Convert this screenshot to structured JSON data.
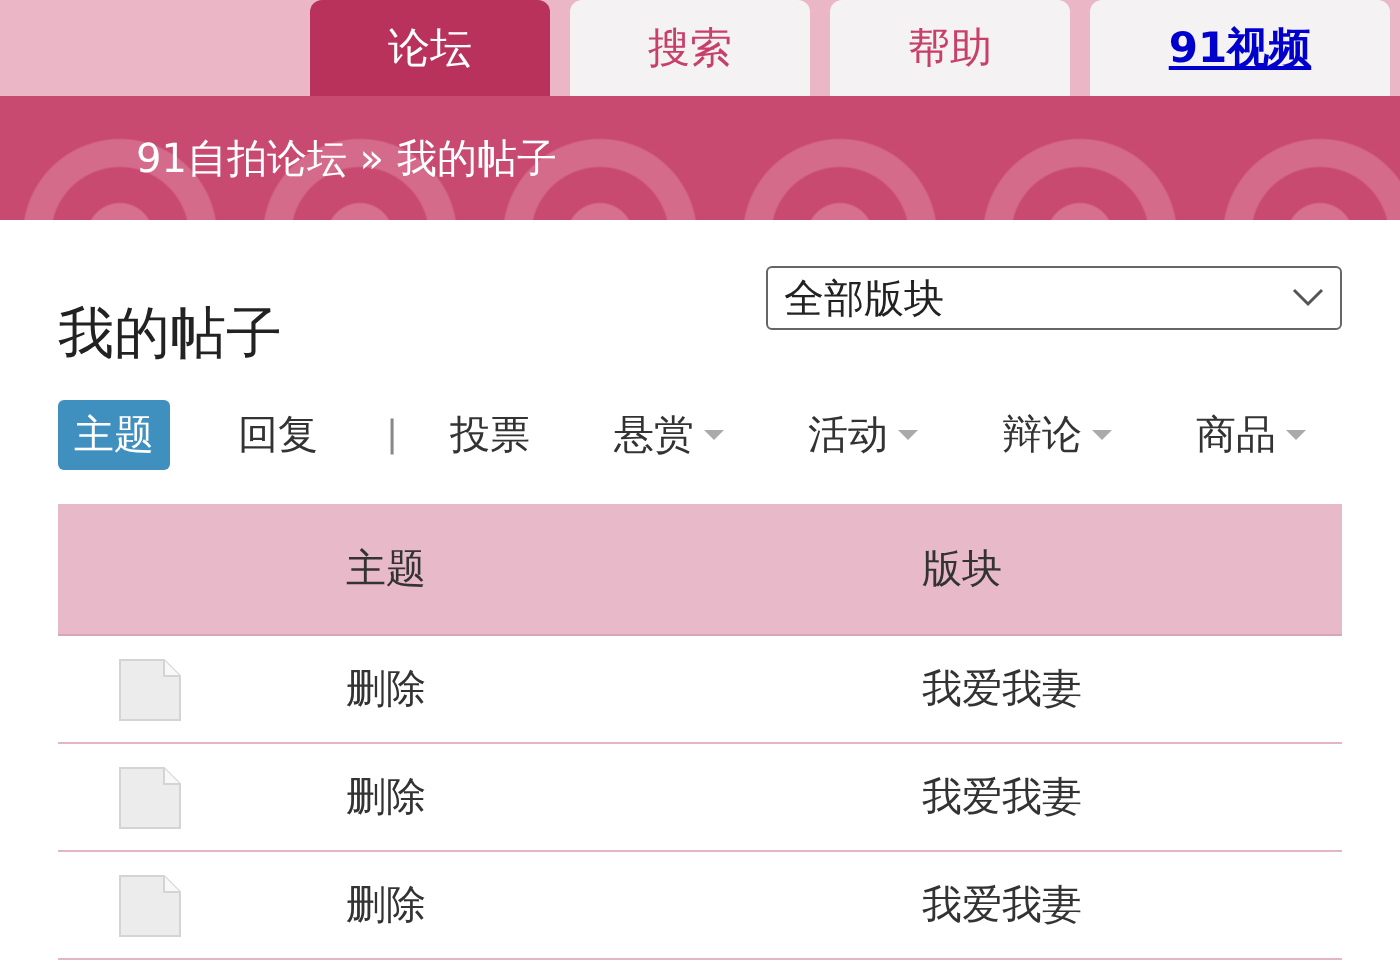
{
  "nav_tabs": [
    {
      "label": "论坛",
      "selected": true,
      "kind": "tab"
    },
    {
      "label": "搜索",
      "selected": false,
      "kind": "tab"
    },
    {
      "label": "帮助",
      "selected": false,
      "kind": "tab"
    },
    {
      "label": "91视频",
      "kind": "link"
    }
  ],
  "breadcrumb": "91自拍论坛 » 我的帖子",
  "page_title": "我的帖子",
  "forum_select": {
    "value": "全部版块"
  },
  "filters": [
    {
      "kind": "tab",
      "label": "主题",
      "selected": true,
      "dropdown": false
    },
    {
      "kind": "tab",
      "label": "回复",
      "selected": false,
      "dropdown": false
    },
    {
      "kind": "separator",
      "label": "|"
    },
    {
      "kind": "tab",
      "label": "投票",
      "selected": false,
      "dropdown": false
    },
    {
      "kind": "tab",
      "label": "悬赏",
      "selected": false,
      "dropdown": true
    },
    {
      "kind": "tab",
      "label": "活动",
      "selected": false,
      "dropdown": true
    },
    {
      "kind": "tab",
      "label": "辩论",
      "selected": false,
      "dropdown": true
    },
    {
      "kind": "tab",
      "label": "商品",
      "selected": false,
      "dropdown": true
    }
  ],
  "table": {
    "columns": [
      "主题",
      "版块"
    ],
    "rows": [
      [
        "删除",
        "我爱我妻"
      ],
      [
        "删除",
        "我爱我妻"
      ],
      [
        "删除",
        "我爱我妻"
      ]
    ]
  }
}
